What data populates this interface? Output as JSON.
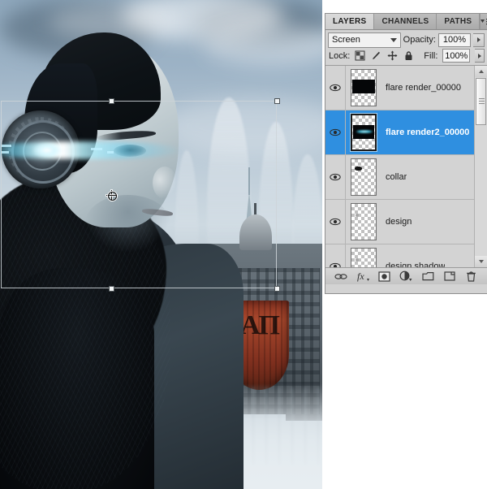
{
  "panel": {
    "tabs": [
      {
        "label": "LAYERS",
        "active": true
      },
      {
        "label": "CHANNELS",
        "active": false
      },
      {
        "label": "PATHS",
        "active": false
      }
    ],
    "menu_icon": "panel-menu-icon",
    "blend_mode": "Screen",
    "opacity_label": "Opacity:",
    "opacity_value": "100%",
    "lock_label": "Lock:",
    "lock_icons": [
      "lock-transparent-pixels-icon",
      "lock-image-pixels-icon",
      "lock-position-icon",
      "lock-all-icon"
    ],
    "fill_label": "Fill:",
    "fill_value": "100%",
    "selection_color": "#2f8fe0",
    "panel_bg": "#d3d3d3",
    "layers": [
      {
        "name": "flare render_00000",
        "visible": true,
        "selected": false,
        "thumb": "dark-flare"
      },
      {
        "name": "flare render2_00000",
        "visible": true,
        "selected": true,
        "thumb": "dark-flare-glow"
      },
      {
        "name": "collar",
        "visible": true,
        "selected": false,
        "thumb": "small-dark-shape"
      },
      {
        "name": "design",
        "visible": true,
        "selected": false,
        "thumb": "faint-shape"
      },
      {
        "name": "design shadow",
        "visible": true,
        "selected": false,
        "thumb": "faint-shape"
      }
    ],
    "footer_buttons": [
      "link-layers-icon",
      "add-layer-style-icon",
      "add-layer-mask-icon",
      "new-fill-adjustment-layer-icon",
      "new-group-icon",
      "new-layer-icon",
      "delete-layer-icon"
    ],
    "scrollbar": {
      "up_arrow": "scroll-up-arrow-icon",
      "down_arrow": "scroll-down-arrow-icon"
    }
  },
  "canvas": {
    "banner_text": "AΠ",
    "transform": {
      "handles": [
        "top-center",
        "top-right",
        "bottom-center",
        "bottom-right"
      ],
      "reference_point": "transform-reference-point"
    }
  }
}
